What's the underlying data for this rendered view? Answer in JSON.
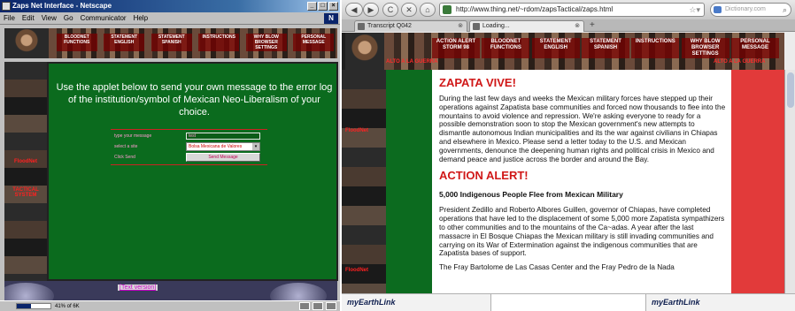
{
  "left_window": {
    "title": "Zaps Net Interface - Netscape",
    "window_buttons": [
      "_",
      "□",
      "×"
    ],
    "menu": [
      "File",
      "Edit",
      "View",
      "Go",
      "Communicator",
      "Help"
    ],
    "throbber_letter": "N",
    "nav_tabs": [
      "BLOODNET FUNCTIONS",
      "STATEMENT ENGLISH",
      "STATEMENT SPANISH",
      "INSTRUCTIONS",
      "WHY BLOW BROWSER SETTINGS",
      "PERSONAL MESSAGE"
    ],
    "side_labels": [
      "FloodNet",
      "TACTICAL SYSTEM"
    ],
    "message": "Use the applet below to send your own message to the error log of the institution/symbol of Mexican Neo-Liberalism of your choice.",
    "applet": {
      "message_label": "type your message",
      "message_value": "test",
      "site_label": "select a site",
      "site_value": "Bolsa Mexicana de Valores",
      "send_label": "Click Send",
      "send_button": "Send Message"
    },
    "text_version_link": "[Text version]",
    "status": {
      "progress_text": "41% of 6K",
      "progress_fraction": 0.41
    }
  },
  "right_window": {
    "nav_buttons": [
      "◀",
      "▶",
      "C",
      "✕",
      "⌂"
    ],
    "url": "http://www.thing.net/~rdom/zapsTactical/zaps.html",
    "search_placeholder": "Dictionary.com",
    "tabs": [
      {
        "label": "Transcript Q042",
        "close": "⊗"
      },
      {
        "label": "Loading...",
        "close": "⊗"
      }
    ],
    "new_tab": "+",
    "nav_tabs": [
      "ACTION ALERT STORM 98",
      "BLOODNET FUNCTIONS",
      "STATEMENT ENGLISH",
      "STATEMENT SPANISH",
      "INSTRUCTIONS",
      "WHY BLOW BROWSER SETTINGS",
      "PERSONAL MESSAGE"
    ],
    "banner_text": [
      "ALTO A LA GUERRA",
      "ALTO A LA GUERRA"
    ],
    "side_labels": [
      "FloodNet",
      "FloodNet"
    ],
    "heading": "ZAPATA VIVE!",
    "paragraph_1": "During the last few days and weeks the Mexican military forces have stepped up their operations against Zapatista base communities and forced now thousands to flee into the mountains to avoid violence and repression. We're asking everyone to ready for a possible demonstration soon to stop the Mexican government's new attempts to dismantle autonomous Indian municipalities and its the war against civilians in Chiapas and elsewhere in Mexico. Please send a letter today to the U.S. and Mexican governments, denounce the deepening human rights and political crisis in Mexico and demand peace and justice across the border and around the Bay.",
    "alert_heading": "ACTION ALERT!",
    "subheading": "5,000 Indigenous People Flee from Mexican Military",
    "paragraph_2": "President Zedillo and Roberto Albores Guillen, governor of Chiapas, have completed operations that have led to the displacement of some 5,000 more Zapatista sympathizers to other communities and to the mountains of the Ca~adas. A year after the last massacre in El Bosque Chiapas the Mexican military is still invading communities and carrying on its War of Extermination against the indigenous communities that are Zapatista bases of support.",
    "paragraph_3": "The Fray Bartolome de Las Casas Center and the Fray Pedro de la Nada",
    "earthlink_left": "myEarthLink",
    "earthlink_right": "myEarthLink"
  },
  "colors": {
    "page_green": "#0b6b1e",
    "alert_red": "#d01818",
    "stripe_red": "#e23a3a",
    "title_blue": "#0a246a"
  },
  "icons": [
    "app-icon",
    "netscape-throbber-icon",
    "back-icon",
    "forward-icon",
    "reload-icon",
    "stop-icon",
    "home-icon",
    "favicon-icon",
    "bookmark-star-icon",
    "search-engine-icon",
    "search-go-icon",
    "tab-close-icon"
  ]
}
